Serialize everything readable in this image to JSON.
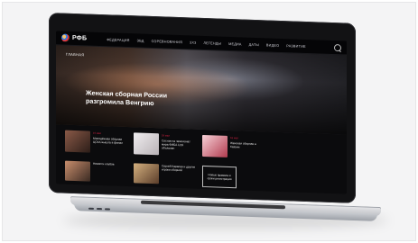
{
  "site": {
    "logo_text": "РФБ",
    "nav": [
      "ФЕДЕРАЦИЯ",
      "ЗБД",
      "СОРЕВНОВАНИЯ",
      "3X3",
      "ЛЕГЕНДЫ",
      "МЕДИА",
      "ДАТЫ",
      "ВИДЕО",
      "РАЗВИТИЕ"
    ]
  },
  "hero": {
    "tag": "ГЛАВНАЯ",
    "title": "Женская сборная России разгромила Венгрию"
  },
  "cards": [
    {
      "meta": "19 мая",
      "text": "Молодёжная сборная ЦСКА вышла в финал"
    },
    {
      "meta": "18 мая",
      "text": "Состав на чемпионат мира ФИБА U19 объявлен"
    },
    {
      "meta": "18 мая",
      "text": "Женская сборная в Казани"
    }
  ],
  "row2": [
    {
      "text": "Новости клубов"
    },
    {
      "text": "Сергей Карасев и другие игроки сборной"
    },
    {
      "text": "Новые правила и сроки регистрации"
    }
  ]
}
